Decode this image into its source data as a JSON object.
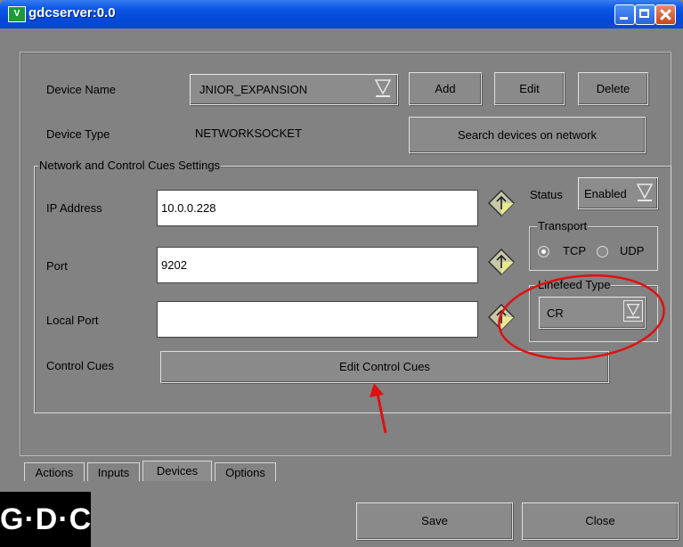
{
  "window": {
    "app_icon_text": "V",
    "title": "gdcserver:0.0"
  },
  "device": {
    "name_label": "Device Name",
    "name_value": "JNIOR_EXPANSION",
    "add_label": "Add",
    "edit_label": "Edit",
    "delete_label": "Delete",
    "type_label": "Device Type",
    "type_value": "NETWORKSOCKET",
    "search_label": "Search devices on network"
  },
  "network": {
    "group_title": "Network and Control Cues Settings",
    "ip_label": "IP Address",
    "ip_value": "10.0.0.228",
    "port_label": "Port",
    "port_value": "9202",
    "local_port_label": "Local Port",
    "local_port_value": "",
    "control_cues_label": "Control Cues",
    "edit_cues_label": "Edit Control Cues"
  },
  "status": {
    "label": "Status",
    "value": "Enabled"
  },
  "transport": {
    "title": "Transport",
    "tcp_label": "TCP",
    "udp_label": "UDP",
    "selected": "TCP"
  },
  "linefeed": {
    "title": "Linefeed Type",
    "value": "CR"
  },
  "tabs": [
    {
      "label": "Actions",
      "active": false
    },
    {
      "label": "Inputs",
      "active": false
    },
    {
      "label": "Devices",
      "active": true
    },
    {
      "label": "Options",
      "active": false
    }
  ],
  "footer": {
    "logo_text": "G·D·C",
    "save_label": "Save",
    "close_label": "Close"
  },
  "annotation_color": "#e01010"
}
